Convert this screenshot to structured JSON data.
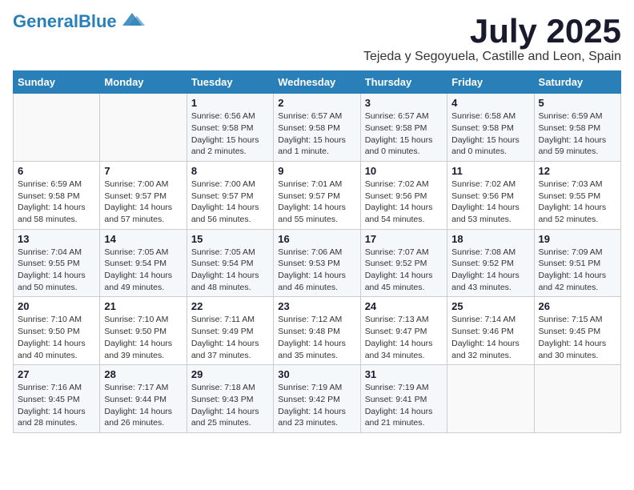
{
  "header": {
    "logo_general": "General",
    "logo_blue": "Blue",
    "month_title": "July 2025",
    "location": "Tejeda y Segoyuela, Castille and Leon, Spain"
  },
  "weekdays": [
    "Sunday",
    "Monday",
    "Tuesday",
    "Wednesday",
    "Thursday",
    "Friday",
    "Saturday"
  ],
  "weeks": [
    [
      {
        "day": "",
        "info": ""
      },
      {
        "day": "",
        "info": ""
      },
      {
        "day": "1",
        "info": "Sunrise: 6:56 AM\nSunset: 9:58 PM\nDaylight: 15 hours and 2 minutes."
      },
      {
        "day": "2",
        "info": "Sunrise: 6:57 AM\nSunset: 9:58 PM\nDaylight: 15 hours and 1 minute."
      },
      {
        "day": "3",
        "info": "Sunrise: 6:57 AM\nSunset: 9:58 PM\nDaylight: 15 hours and 0 minutes."
      },
      {
        "day": "4",
        "info": "Sunrise: 6:58 AM\nSunset: 9:58 PM\nDaylight: 15 hours and 0 minutes."
      },
      {
        "day": "5",
        "info": "Sunrise: 6:59 AM\nSunset: 9:58 PM\nDaylight: 14 hours and 59 minutes."
      }
    ],
    [
      {
        "day": "6",
        "info": "Sunrise: 6:59 AM\nSunset: 9:58 PM\nDaylight: 14 hours and 58 minutes."
      },
      {
        "day": "7",
        "info": "Sunrise: 7:00 AM\nSunset: 9:57 PM\nDaylight: 14 hours and 57 minutes."
      },
      {
        "day": "8",
        "info": "Sunrise: 7:00 AM\nSunset: 9:57 PM\nDaylight: 14 hours and 56 minutes."
      },
      {
        "day": "9",
        "info": "Sunrise: 7:01 AM\nSunset: 9:57 PM\nDaylight: 14 hours and 55 minutes."
      },
      {
        "day": "10",
        "info": "Sunrise: 7:02 AM\nSunset: 9:56 PM\nDaylight: 14 hours and 54 minutes."
      },
      {
        "day": "11",
        "info": "Sunrise: 7:02 AM\nSunset: 9:56 PM\nDaylight: 14 hours and 53 minutes."
      },
      {
        "day": "12",
        "info": "Sunrise: 7:03 AM\nSunset: 9:55 PM\nDaylight: 14 hours and 52 minutes."
      }
    ],
    [
      {
        "day": "13",
        "info": "Sunrise: 7:04 AM\nSunset: 9:55 PM\nDaylight: 14 hours and 50 minutes."
      },
      {
        "day": "14",
        "info": "Sunrise: 7:05 AM\nSunset: 9:54 PM\nDaylight: 14 hours and 49 minutes."
      },
      {
        "day": "15",
        "info": "Sunrise: 7:05 AM\nSunset: 9:54 PM\nDaylight: 14 hours and 48 minutes."
      },
      {
        "day": "16",
        "info": "Sunrise: 7:06 AM\nSunset: 9:53 PM\nDaylight: 14 hours and 46 minutes."
      },
      {
        "day": "17",
        "info": "Sunrise: 7:07 AM\nSunset: 9:52 PM\nDaylight: 14 hours and 45 minutes."
      },
      {
        "day": "18",
        "info": "Sunrise: 7:08 AM\nSunset: 9:52 PM\nDaylight: 14 hours and 43 minutes."
      },
      {
        "day": "19",
        "info": "Sunrise: 7:09 AM\nSunset: 9:51 PM\nDaylight: 14 hours and 42 minutes."
      }
    ],
    [
      {
        "day": "20",
        "info": "Sunrise: 7:10 AM\nSunset: 9:50 PM\nDaylight: 14 hours and 40 minutes."
      },
      {
        "day": "21",
        "info": "Sunrise: 7:10 AM\nSunset: 9:50 PM\nDaylight: 14 hours and 39 minutes."
      },
      {
        "day": "22",
        "info": "Sunrise: 7:11 AM\nSunset: 9:49 PM\nDaylight: 14 hours and 37 minutes."
      },
      {
        "day": "23",
        "info": "Sunrise: 7:12 AM\nSunset: 9:48 PM\nDaylight: 14 hours and 35 minutes."
      },
      {
        "day": "24",
        "info": "Sunrise: 7:13 AM\nSunset: 9:47 PM\nDaylight: 14 hours and 34 minutes."
      },
      {
        "day": "25",
        "info": "Sunrise: 7:14 AM\nSunset: 9:46 PM\nDaylight: 14 hours and 32 minutes."
      },
      {
        "day": "26",
        "info": "Sunrise: 7:15 AM\nSunset: 9:45 PM\nDaylight: 14 hours and 30 minutes."
      }
    ],
    [
      {
        "day": "27",
        "info": "Sunrise: 7:16 AM\nSunset: 9:45 PM\nDaylight: 14 hours and 28 minutes."
      },
      {
        "day": "28",
        "info": "Sunrise: 7:17 AM\nSunset: 9:44 PM\nDaylight: 14 hours and 26 minutes."
      },
      {
        "day": "29",
        "info": "Sunrise: 7:18 AM\nSunset: 9:43 PM\nDaylight: 14 hours and 25 minutes."
      },
      {
        "day": "30",
        "info": "Sunrise: 7:19 AM\nSunset: 9:42 PM\nDaylight: 14 hours and 23 minutes."
      },
      {
        "day": "31",
        "info": "Sunrise: 7:19 AM\nSunset: 9:41 PM\nDaylight: 14 hours and 21 minutes."
      },
      {
        "day": "",
        "info": ""
      },
      {
        "day": "",
        "info": ""
      }
    ]
  ]
}
